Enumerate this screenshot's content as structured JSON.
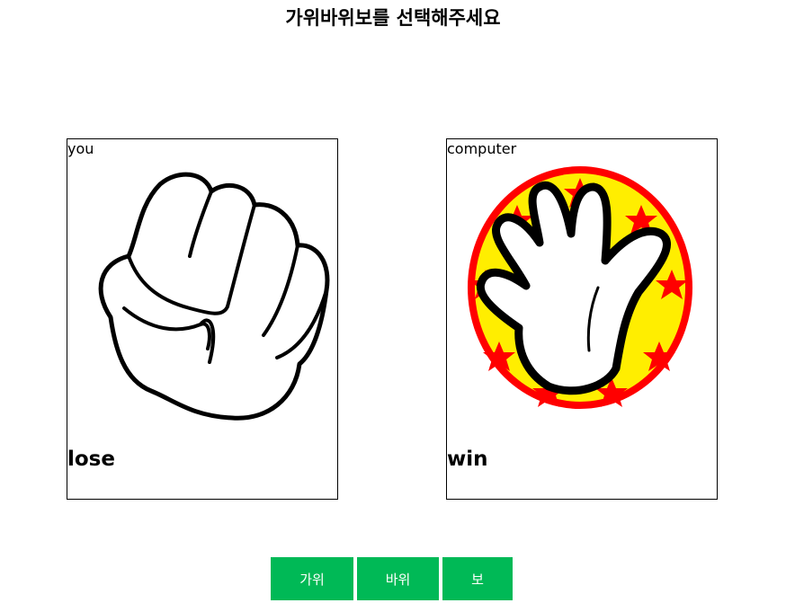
{
  "page": {
    "title": "가위바위보를 선택해주세요"
  },
  "player": {
    "label": "you",
    "hand_icon": "rock-fist-icon",
    "result": "lose"
  },
  "computer": {
    "label": "computer",
    "hand_icon": "paper-hand-icon",
    "result": "win"
  },
  "buttons": {
    "scissors": "가위",
    "rock": "바위",
    "paper": "보"
  },
  "colors": {
    "button_bg": "#00b956",
    "button_text": "#ffffff",
    "badge_ring": "#ff0000",
    "badge_fill": "#ffee00"
  }
}
